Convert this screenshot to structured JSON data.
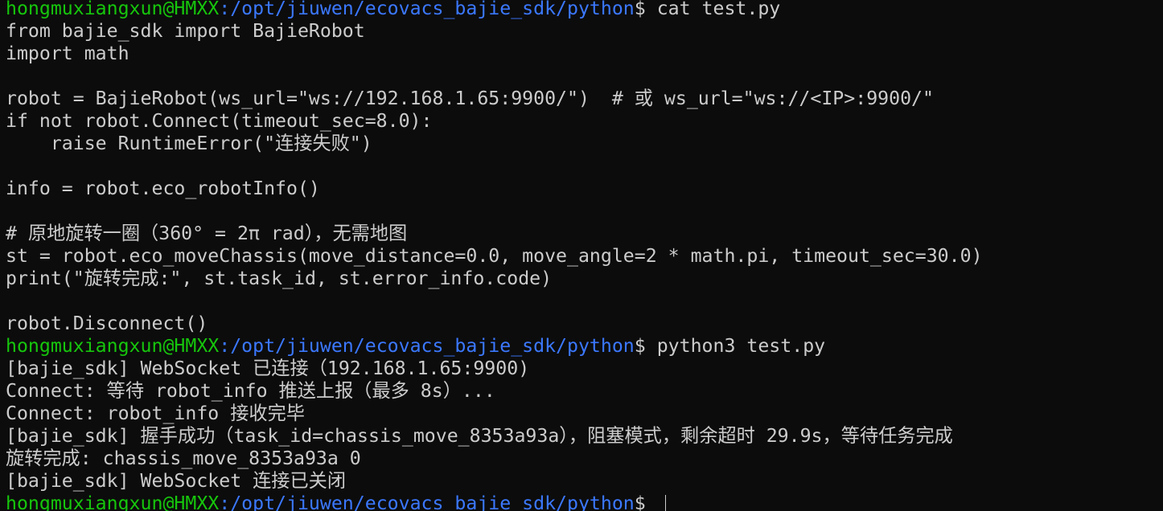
{
  "terminal": {
    "prompt": {
      "user_host": "hongmuxiangxun@HMXX",
      "path": ":/opt/jiuwen/ecovacs_bajie_sdk/python",
      "symbol": "$"
    },
    "lines": [
      {
        "type": "prompt",
        "command": " cat test.py"
      },
      {
        "type": "text",
        "text": "from bajie_sdk import BajieRobot"
      },
      {
        "type": "text",
        "text": "import math"
      },
      {
        "type": "text",
        "text": ""
      },
      {
        "type": "text",
        "text": "robot = BajieRobot(ws_url=\"ws://192.168.1.65:9900/\")  # 或 ws_url=\"ws://<IP>:9900/\""
      },
      {
        "type": "text",
        "text": "if not robot.Connect(timeout_sec=8.0):"
      },
      {
        "type": "text",
        "text": "    raise RuntimeError(\"连接失败\")"
      },
      {
        "type": "text",
        "text": ""
      },
      {
        "type": "text",
        "text": "info = robot.eco_robotInfo()"
      },
      {
        "type": "text",
        "text": ""
      },
      {
        "type": "text",
        "text": "# 原地旋转一圈（360° = 2π rad），无需地图"
      },
      {
        "type": "text",
        "text": "st = robot.eco_moveChassis(move_distance=0.0, move_angle=2 * math.pi, timeout_sec=30.0)"
      },
      {
        "type": "text",
        "text": "print(\"旋转完成:\", st.task_id, st.error_info.code)"
      },
      {
        "type": "text",
        "text": ""
      },
      {
        "type": "text",
        "text": "robot.Disconnect()"
      },
      {
        "type": "prompt",
        "command": " python3 test.py"
      },
      {
        "type": "text",
        "text": "[bajie_sdk] WebSocket 已连接（192.168.1.65:9900)"
      },
      {
        "type": "text",
        "text": "Connect: 等待 robot_info 推送上报（最多 8s）..."
      },
      {
        "type": "text",
        "text": "Connect: robot_info 接收完毕"
      },
      {
        "type": "text",
        "text": "[bajie_sdk] 握手成功（task_id=chassis_move_8353a93a），阻塞模式，剩余超时 29.9s，等待任务完成"
      },
      {
        "type": "text",
        "text": "旋转完成: chassis_move_8353a93a 0"
      },
      {
        "type": "text",
        "text": "[bajie_sdk] WebSocket 连接已关闭"
      },
      {
        "type": "prompt",
        "command": " ",
        "cursor": true
      }
    ]
  },
  "colors": {
    "background": "#0c0c0c",
    "text": "#cccccc",
    "user_host": "#16c60c",
    "path": "#3b78ff"
  }
}
